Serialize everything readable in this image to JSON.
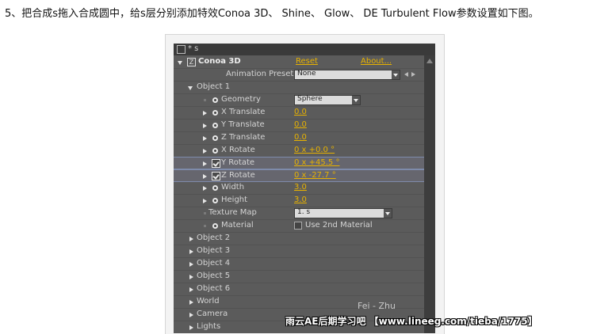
{
  "caption": "5、把合成s拖入合成圆中，给s层分别添加特效Conoa 3D、 Shine、 Glow、 DE Turbulent Flow参数设置如下图。",
  "panel": {
    "title": "* s",
    "effect": {
      "name": "Conoa 3D",
      "reset": "Reset",
      "about": "About..."
    },
    "animation_presets": {
      "label": "Animation Presets:",
      "value": "None"
    },
    "object1_label": "Object 1",
    "params": {
      "geometry": {
        "label": "Geometry",
        "value": "Sphere"
      },
      "x_translate": {
        "label": "X Translate",
        "value": "0.0"
      },
      "y_translate": {
        "label": "Y Translate",
        "value": "0.0"
      },
      "z_translate": {
        "label": "Z Translate",
        "value": "0.0"
      },
      "x_rotate": {
        "label": "X Rotate",
        "value": "0 x +0.0 °"
      },
      "y_rotate": {
        "label": "Y Rotate",
        "value": "0 x +45.5 °"
      },
      "z_rotate": {
        "label": "Z Rotate",
        "value": "0 x -27.7 °"
      },
      "width": {
        "label": "Width",
        "value": "3.0"
      },
      "height": {
        "label": "Height",
        "value": "3.0"
      },
      "texture_map": {
        "label": "Texture Map",
        "value": "1. s"
      },
      "material": {
        "label": "Material",
        "checkbox_label": "Use 2nd Material",
        "checked": false
      }
    },
    "groups": [
      "Object 2",
      "Object 3",
      "Object 4",
      "Object 5",
      "Object 6",
      "World",
      "Camera",
      "Lights"
    ]
  },
  "watermark": {
    "faint": "Fei - Zhu",
    "main": "雨云AE后期学习吧 【www.lineeg.com/tieba/1775】"
  },
  "colors": {
    "panel_bg": "#5b5b5b",
    "value_accent": "#e8b200",
    "highlight_row": "#66666e"
  }
}
